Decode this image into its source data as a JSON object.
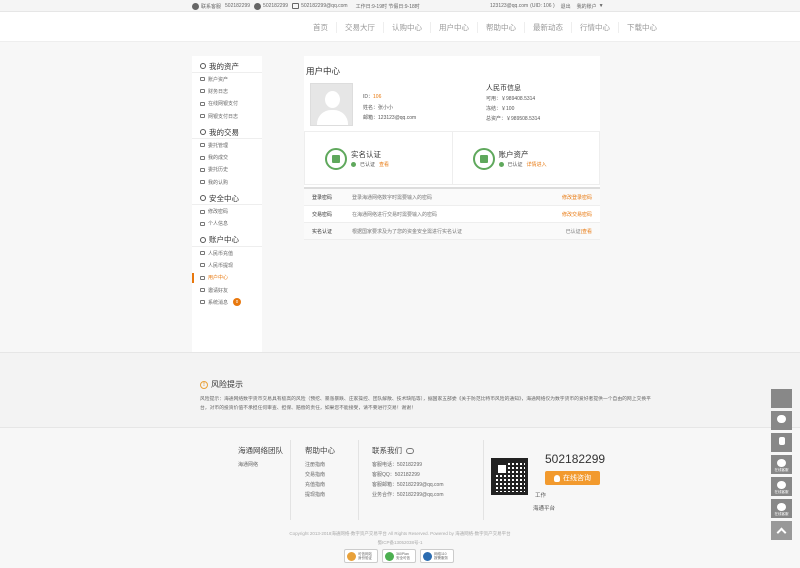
{
  "topbar": {
    "service_label": "联系客服",
    "qq": "502182299",
    "phone": "502182299",
    "email": "502182299@qq.com",
    "hours": "工作日:9-19时 节假日:9-18时",
    "user": "123123@qq.com",
    "uid": "(UID: 106 )",
    "logout": "退出",
    "account": "我的账户"
  },
  "nav": [
    "首页",
    "交易大厅",
    "认购中心",
    "用户中心",
    "帮助中心",
    "最新动态",
    "行情中心",
    "下载中心"
  ],
  "sidebar": [
    {
      "title": "我的资产",
      "items": [
        "账户资产",
        "财务日志",
        "在线网银支付",
        "网银支付日志"
      ]
    },
    {
      "title": "我的交易",
      "items": [
        "委托管理",
        "我的成交",
        "委托历史",
        "我的认购"
      ]
    },
    {
      "title": "安全中心",
      "items": [
        "修改密码",
        "个人信息"
      ]
    },
    {
      "title": "账户中心",
      "items": [
        "人民币充值",
        "人民币提现",
        "用户中心",
        "邀请好友",
        "系统消息"
      ],
      "active_index": 2,
      "badge": "0"
    }
  ],
  "user_center": {
    "title": "用户中心",
    "id_label": "ID：",
    "id_value": "106",
    "name_label": "姓名：",
    "name_value": "张小小",
    "email_label": "邮箱：",
    "email_value": "123123@qq.com",
    "rmb_title": "人民币信息",
    "available_label": "可用：",
    "available_value": "￥989408.5314",
    "frozen_label": "冻结：",
    "frozen_value": "￥100",
    "total_label": "总资产：",
    "total_value": "￥989508.5314"
  },
  "cards": [
    {
      "title": "实名认证",
      "status": "已认证",
      "link": "查看"
    },
    {
      "title": "账户资产",
      "status": "已认证",
      "link": "详情进入"
    }
  ],
  "security_rows": [
    {
      "name": "登录密码",
      "desc": "登录海通网络数字时需要输入的密码",
      "action": "修改登录密码",
      "status": ""
    },
    {
      "name": "交易密码",
      "desc": "在海通网络进行交易时需要输入的密码",
      "action": "修改交易密码",
      "status": ""
    },
    {
      "name": "实名认证",
      "desc": "根据国家要求及为了您的资金安全需进行实名认证",
      "action": "查看",
      "status": "已认证"
    }
  ],
  "risk": {
    "title": "风险提示",
    "text": "风险提示：海通网络数字货币交易具有极高的风险（预挖、暴涨暴跌、庄家操控、团队解散、技术缺陷等），据国家五部委《关于防范比特币风险的通知》，海通网络仅为数字货币的爱好者提供一个自由的网上交换平台，对币的投资价值不承担任何审查、担保、赔偿的责任，如果您不能接受，请不要进行交易！谢谢！"
  },
  "footer": {
    "team_title": "海通网络团队",
    "team_items": [
      "海通网络"
    ],
    "help_title": "帮助中心",
    "help_items": [
      "注册指南",
      "交易指南",
      "充值指南",
      "提现指南"
    ],
    "contact_title": "联系我们",
    "contact_items": [
      "客服电话：502182299",
      "客服QQ：502182299",
      "客服邮箱：502182299@qq.com",
      "业务合作：502182299@qq.com"
    ],
    "phone": "502182299",
    "qq_button": "在线咨询",
    "work": "工作",
    "brand": "海通平台",
    "copyright": "Copyright 2013-2018海通网络-数字资产交易平台 All Rights Reserved. Powered by 海通网络-数字资产交易平台",
    "icp": "蜀ICP备13052038号-1",
    "badges": [
      {
        "line1": "可信网站",
        "line2": "身份验证"
      },
      {
        "line1": "360Plan",
        "line2": "安全可信"
      },
      {
        "line1": "网络110",
        "line2": "报警服务"
      }
    ]
  },
  "float_toolbar": [
    "",
    "",
    "",
    "在线客服",
    "在线客服",
    "在线客服",
    ""
  ],
  "colors": {
    "accent": "#e8780e",
    "green": "#5fa85c",
    "qq_button": "#f29a2e"
  }
}
